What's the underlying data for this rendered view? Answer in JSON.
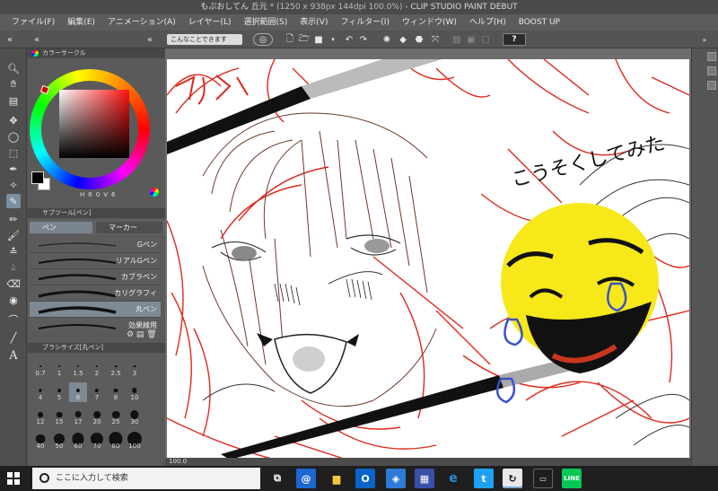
{
  "window": {
    "title_prefix": "もぶおしてん 丘元",
    "title_detail": "* (1250 x 938px 144dpi 100.0%)",
    "title_app": "- CLIP STUDIO PAINT DEBUT"
  },
  "menu": [
    "ファイル(F)",
    "編集(E)",
    "アニメーション(A)",
    "レイヤー(L)",
    "選択範囲(S)",
    "表示(V)",
    "フィルター(I)",
    "ウィンドウ(W)",
    "ヘルプ(H)",
    "BOOST UP"
  ],
  "command_bar": {
    "pill_label": "こんなことできます",
    "help_label": "?"
  },
  "color_panel": {
    "tab_label": "カラーサークル",
    "hsv_label": "H",
    "hsv_values": [
      "6",
      "0",
      "V",
      "6"
    ],
    "main_color": "#000000",
    "sub_color": "#ffffff"
  },
  "sub_tool": {
    "tab_label": "サブツール[ペン]",
    "tab_pen": "ペン",
    "tab_marker": "マーカー",
    "brushes": [
      "Gペン",
      "リアルGペン",
      "カブラペン",
      "カリグラフィ",
      "丸ペン",
      "効果線用"
    ],
    "selected_brush": "丸ペン"
  },
  "brush_size": {
    "tab_label": "ブラシサイズ[丸ペン]",
    "sizes": [
      "0.7",
      "1",
      "1.5",
      "2",
      "2.5",
      "3",
      "4",
      "5",
      "6",
      "7",
      "8",
      "10",
      "12",
      "15",
      "17",
      "20",
      "25",
      "30",
      "40",
      "50",
      "60",
      "70",
      "80",
      "100"
    ],
    "selected_size": "6"
  },
  "canvas": {
    "handwritten_text": "こうそくしてみた",
    "zoom": "100.0"
  },
  "taskbar": {
    "search_placeholder": "ここに入力して検索"
  },
  "colors": {
    "accent_selection": "#7d8994",
    "sketch_red": "#e0281c",
    "emoji_yellow": "#f7e81a",
    "tear_blue": "#3a52c8"
  }
}
